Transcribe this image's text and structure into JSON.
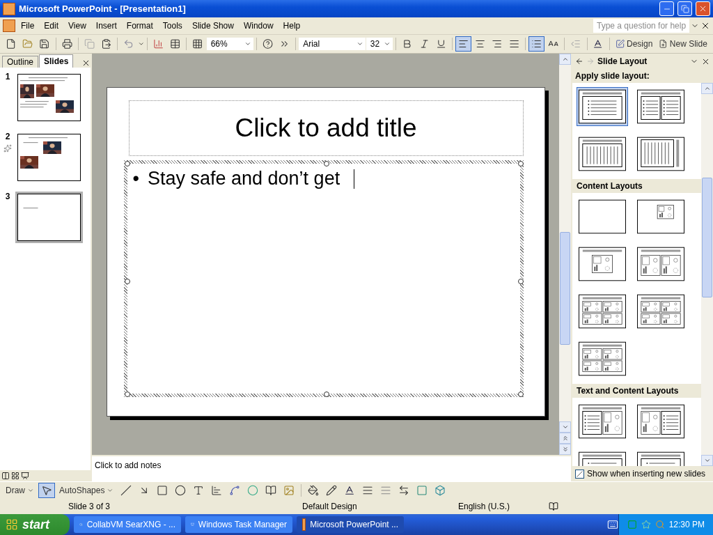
{
  "window": {
    "title": "Microsoft PowerPoint - [Presentation1]"
  },
  "menu": [
    "File",
    "Edit",
    "View",
    "Insert",
    "Format",
    "Tools",
    "Slide Show",
    "Window",
    "Help"
  ],
  "help_field": {
    "placeholder": "Type a question for help"
  },
  "toolbar": {
    "zoom": "66%",
    "font": "Arial",
    "font_size": "32",
    "alignment": [
      {
        "selected": true
      },
      {
        "selected": false
      },
      {
        "selected": false
      }
    ],
    "bullets_on": true,
    "design": "Design",
    "new_slide": "New Slide"
  },
  "side_pane": {
    "tabs": [
      {
        "label": "Outline",
        "selected": false
      },
      {
        "label": "Slides",
        "selected": true
      }
    ],
    "slides": [
      {
        "number": "1",
        "selected": false,
        "animated": false,
        "kind": "three-pictures"
      },
      {
        "number": "2",
        "selected": false,
        "animated": true,
        "kind": "two-pictures"
      },
      {
        "number": "3",
        "selected": true,
        "animated": false,
        "kind": "text-only"
      }
    ]
  },
  "slide": {
    "title_placeholder": "Click to add title",
    "bullet": "•",
    "body": "Stay safe and don’t get "
  },
  "notes": {
    "placeholder": "Click to add notes"
  },
  "task_pane": {
    "title": "Slide Layout",
    "heading": "Apply slide layout:",
    "sections": [
      {
        "layouts": [
          {
            "kind": "title-text",
            "selected": true
          },
          {
            "kind": "two-text",
            "selected": false
          },
          {
            "kind": "vertical-text",
            "selected": false
          },
          {
            "kind": "vertical-title-text",
            "selected": false
          }
        ]
      },
      {
        "heading": "Content Layouts",
        "layouts": [
          {
            "kind": "blank",
            "selected": false
          },
          {
            "kind": "content",
            "selected": false
          },
          {
            "kind": "title-content",
            "selected": false
          },
          {
            "kind": "two-content",
            "selected": false
          },
          {
            "kind": "four-content",
            "selected": false
          },
          {
            "kind": "four-content",
            "selected": false
          },
          {
            "kind": "four-content",
            "selected": false
          }
        ]
      },
      {
        "heading": "Text and Content Layouts",
        "layouts": [
          {
            "kind": "text-content",
            "selected": false
          },
          {
            "kind": "content-text",
            "selected": false
          },
          {
            "kind": "title-text",
            "selected": false
          },
          {
            "kind": "title-text",
            "selected": false
          }
        ]
      }
    ],
    "checkbox": {
      "label": "Show when inserting new slides",
      "checked": true
    }
  },
  "drawing_toolbar": {
    "draw": "Draw",
    "autoshapes": "AutoShapes"
  },
  "status_bar": [
    "Slide 3 of 3",
    "Default Design",
    "English (U.S.)"
  ],
  "taskbar": {
    "start": "start",
    "tasks": [
      {
        "label": "CollabVM SearXNG - ...",
        "selected": false,
        "kind": "browser"
      },
      {
        "label": "Windows Task Manager",
        "selected": false,
        "kind": "monitor"
      },
      {
        "label": "Microsoft PowerPoint ...",
        "selected": true,
        "kind": "powerpoint"
      }
    ],
    "clock": "12:30 PM"
  }
}
